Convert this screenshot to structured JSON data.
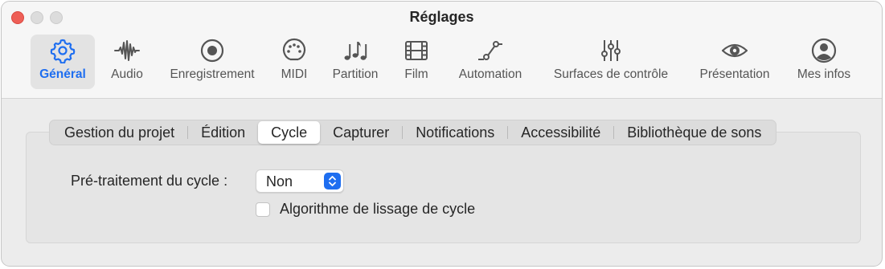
{
  "window": {
    "title": "Réglages"
  },
  "toolbar": {
    "items": [
      {
        "label": "Général",
        "icon": "gear-icon",
        "active": true
      },
      {
        "label": "Audio",
        "icon": "waveform-icon"
      },
      {
        "label": "Enregistrement",
        "icon": "record-icon"
      },
      {
        "label": "MIDI",
        "icon": "midi-port-icon"
      },
      {
        "label": "Partition",
        "icon": "music-notes-icon"
      },
      {
        "label": "Film",
        "icon": "film-icon"
      },
      {
        "label": "Automation",
        "icon": "automation-curve-icon"
      },
      {
        "label": "Surfaces de contrôle",
        "icon": "faders-icon"
      },
      {
        "label": "Présentation",
        "icon": "eye-icon"
      },
      {
        "label": "Mes infos",
        "icon": "person-icon"
      }
    ]
  },
  "tabs": {
    "items": [
      "Gestion du projet",
      "Édition",
      "Cycle",
      "Capturer",
      "Notifications",
      "Accessibilité",
      "Bibliothèque de sons"
    ],
    "selected": "Cycle"
  },
  "cycle": {
    "preprocess_label": "Pré-traitement du cycle :",
    "preprocess_value": "Non",
    "smoothing_label": "Algorithme de lissage de cycle",
    "smoothing_checked": false
  },
  "colors": {
    "accent": "#1e6ef0",
    "close": "#ee5f57"
  }
}
